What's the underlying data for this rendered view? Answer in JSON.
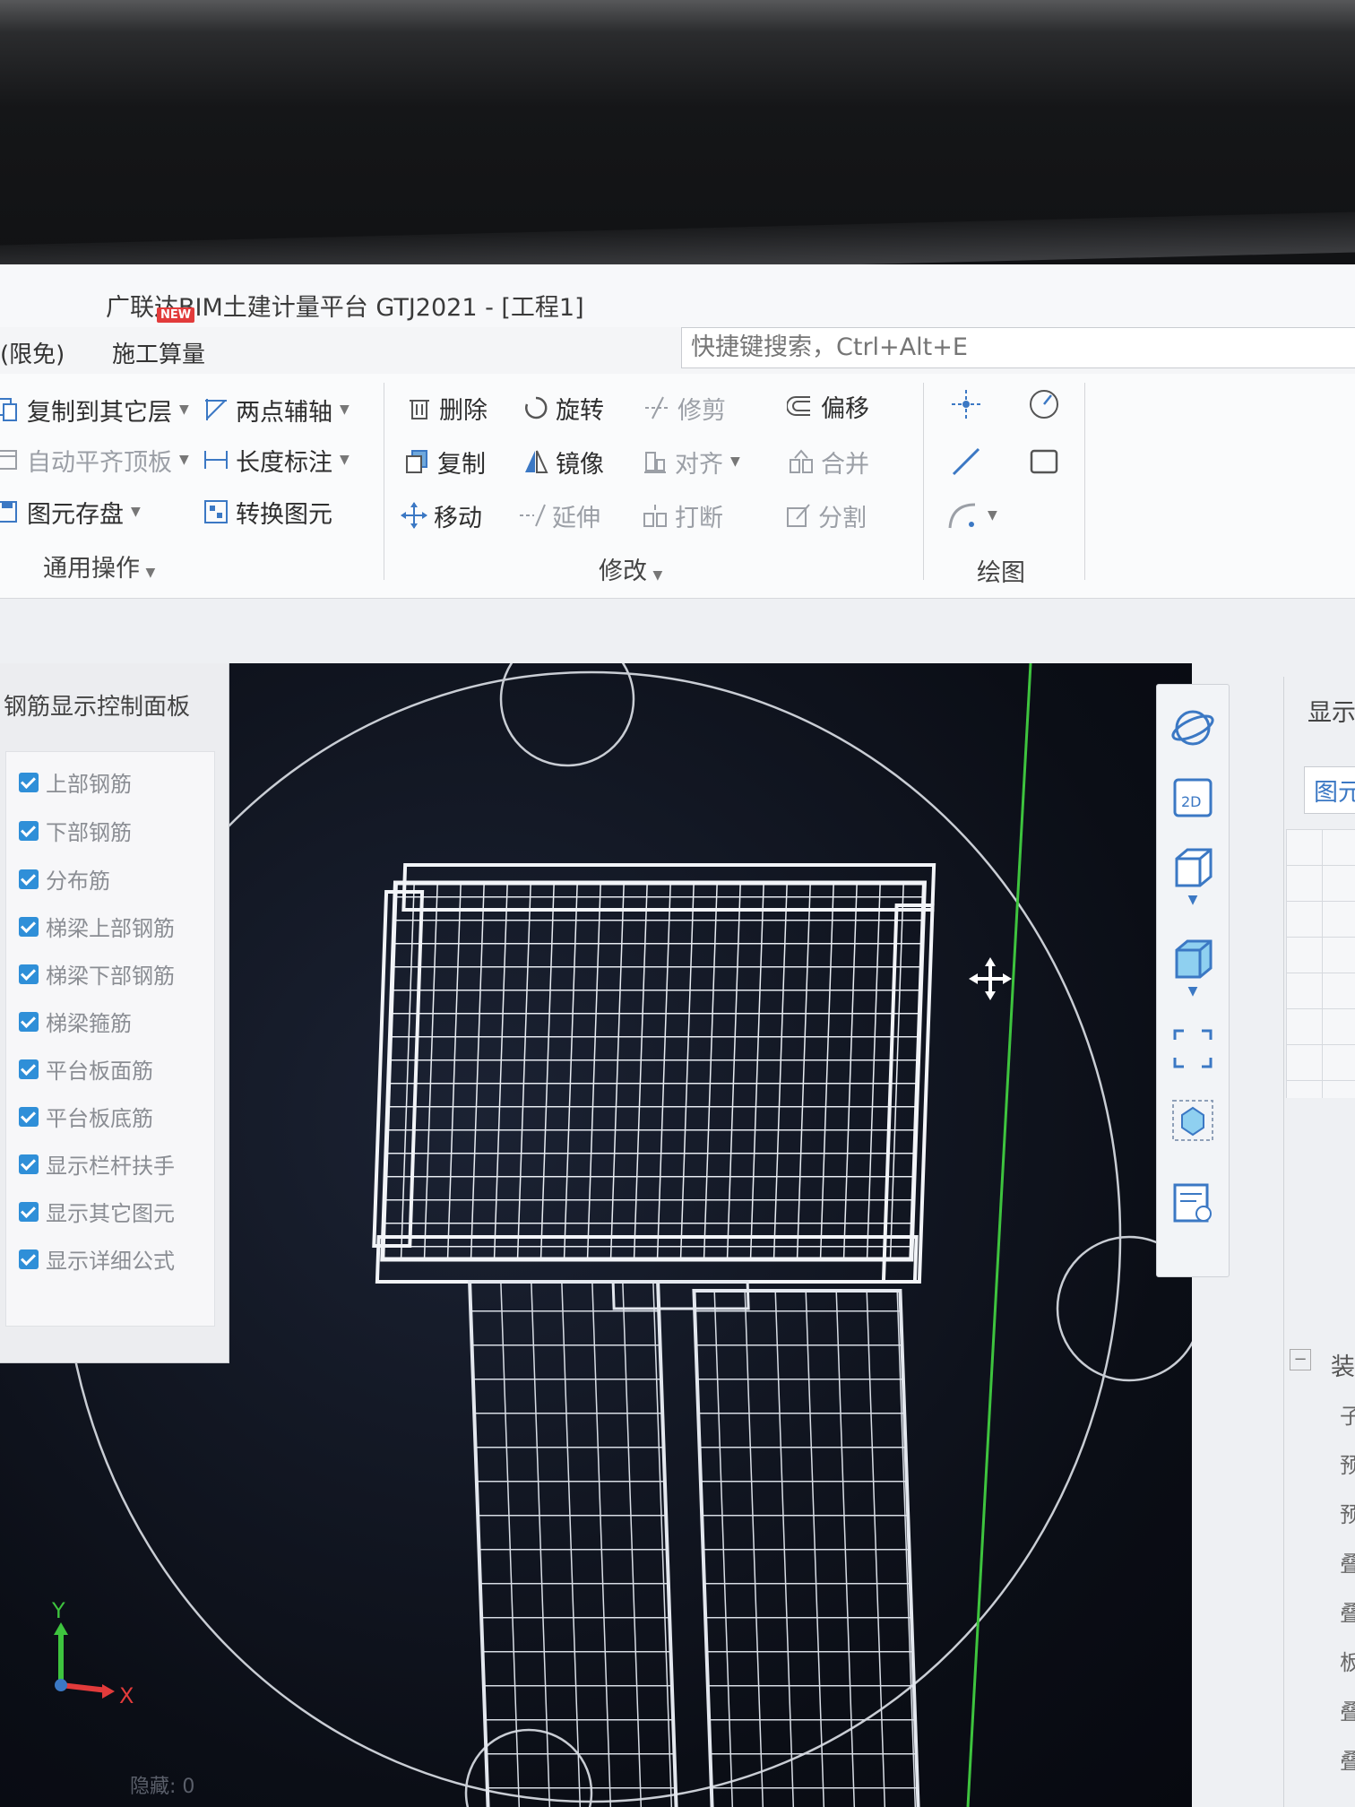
{
  "window": {
    "title": "广联达BIM土建计量平台 GTJ2021 - [工程1]",
    "new_badge": "NEW"
  },
  "menubar": {
    "items": [
      "(限免)",
      "施工算量"
    ],
    "search_placeholder": "快捷键搜索，Ctrl+Alt+E"
  },
  "ribbon": {
    "general": {
      "label": "通用操作",
      "copy_to_layer": "复制到其它层",
      "auto_flush_slab": "自动平齐顶板",
      "save_element": "图元存盘",
      "two_point_axis": "两点辅轴",
      "length_dim": "长度标注",
      "convert_element": "转换图元"
    },
    "modify": {
      "label": "修改",
      "delete": "删除",
      "rotate": "旋转",
      "trim": "修剪",
      "offset": "偏移",
      "copy": "复制",
      "mirror": "镜像",
      "align": "对齐",
      "merge": "合并",
      "move": "移动",
      "extend": "延伸",
      "break": "打断",
      "split": "分割"
    },
    "draw": {
      "label": "绘图"
    }
  },
  "rebar_panel": {
    "title": "钢筋显示控制面板",
    "items": [
      {
        "label": "上部钢筋",
        "checked": true
      },
      {
        "label": "下部钢筋",
        "checked": true
      },
      {
        "label": "分布筋",
        "checked": true
      },
      {
        "label": "梯梁上部钢筋",
        "checked": true
      },
      {
        "label": "梯梁下部钢筋",
        "checked": true
      },
      {
        "label": "梯梁箍筋",
        "checked": true
      },
      {
        "label": "平台板面筋",
        "checked": true
      },
      {
        "label": "平台板底筋",
        "checked": true
      },
      {
        "label": "显示栏杆扶手",
        "checked": true
      },
      {
        "label": "显示其它图元",
        "checked": true
      },
      {
        "label": "显示详细公式",
        "checked": true
      }
    ]
  },
  "view_toolbar": {
    "icons": [
      "orbit-icon",
      "2d-view-icon",
      "3d-wire-icon",
      "3d-solid-icon",
      "fit-view-icon",
      "view-cube-icon",
      "properties-icon"
    ],
    "two_d_label": "2D"
  },
  "right_panel": {
    "tab_display": "显示",
    "tab_element": "图元",
    "collapse_glyph": "−",
    "section_char": "装",
    "side_chars": [
      "子",
      "预",
      "预",
      "叠",
      "叠",
      "板",
      "叠",
      "叠"
    ]
  },
  "axes": {
    "y": "Y",
    "x": "X"
  },
  "status": {
    "text": "隐藏: 0"
  },
  "colors": {
    "accent_blue": "#2f8fd8",
    "viewport_bg": "#0b0e16",
    "wire": "#e8ecf2",
    "axis_green": "#3ec43e",
    "axis_red": "#e23b3b"
  }
}
